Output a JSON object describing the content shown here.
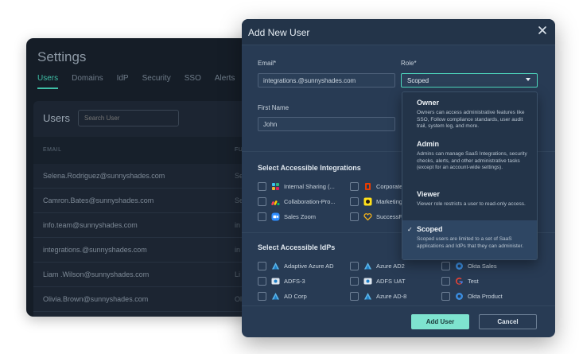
{
  "settings": {
    "title": "Settings",
    "tabs": [
      "Users",
      "Domains",
      "IdP",
      "Security",
      "SSO",
      "Alerts"
    ],
    "users_label": "Users",
    "search_placeholder": "Search User",
    "col_email": "EMAIL",
    "col_second": "FU",
    "rows": [
      {
        "email": "Selena.Rodriguez@sunnyshades.com",
        "second": "Se"
      },
      {
        "email": "Camron.Bates@sunnyshades.com",
        "second": "Se"
      },
      {
        "email": "info.team@sunnyshades.com",
        "second": "in"
      },
      {
        "email": "integrations.@sunnyshades.com",
        "second": "in"
      },
      {
        "email": "Liam .Wilson@sunnyshades.com",
        "second": "Li"
      },
      {
        "email": "Olivia.Brown@sunnyshades.com",
        "second": "Ol"
      }
    ]
  },
  "modal": {
    "title": "Add New User",
    "email_label": "Email*",
    "email_value": "integrations.@sunnyshades.com",
    "role_label": "Role*",
    "role_value": "Scoped",
    "first_name_label": "First Name",
    "first_name_value": "John",
    "integrations_title": "Select Accessible Integrations",
    "integrations": [
      {
        "label": "Internal Sharing (...",
        "icon": "slack-icon"
      },
      {
        "label": "Corporate",
        "icon": "office-icon"
      },
      {
        "label": "Collaboration-Pro...",
        "icon": "monday-icon"
      },
      {
        "label": "Marketing",
        "icon": "mailchimp-icon"
      },
      {
        "label": "Sales Zoom",
        "icon": "zoom-icon"
      },
      {
        "label": "SuccessF",
        "icon": "heart-icon"
      }
    ],
    "idps_title": "Select Accessible IdPs",
    "idps": [
      {
        "label": "Adaptive Azure AD",
        "icon": "azure-icon"
      },
      {
        "label": "Azure AD2",
        "icon": "azure-icon"
      },
      {
        "label": "Okta Sales",
        "icon": "okta-icon"
      },
      {
        "label": "ADFS-3",
        "icon": "adfs-icon"
      },
      {
        "label": "ADFS UAT",
        "icon": "adfs-icon"
      },
      {
        "label": "Test",
        "icon": "google-icon"
      },
      {
        "label": "AD Corp",
        "icon": "azure-icon"
      },
      {
        "label": "Azure AD-8",
        "icon": "azure-icon"
      },
      {
        "label": "Okta Product",
        "icon": "okta-icon"
      }
    ],
    "add_button": "Add User",
    "cancel_button": "Cancel"
  },
  "role_menu": {
    "options": [
      {
        "title": "Owner",
        "desc": "Owners can access administrative features like SSO, Follow compliance standards, user audit trail, system log, and more.",
        "selected": false
      },
      {
        "title": "Admin",
        "desc": "Admins can manage SaaS Integrations, security checks, alerts, and other administrative tasks (except for an account-wide settings).",
        "selected": false
      },
      {
        "title": "Viewer",
        "desc": "Viewer role restricts a user to read-only access.",
        "selected": false
      },
      {
        "title": "Scoped",
        "desc": "Scoped users are limited to a set of SaaS applications and IdPs that they can administer.",
        "selected": true
      }
    ]
  },
  "colors": {
    "accent": "#4ed8be",
    "primary_button": "#7ee3cf",
    "modal_bg": "#283b54",
    "page_bg": "#151d27"
  }
}
